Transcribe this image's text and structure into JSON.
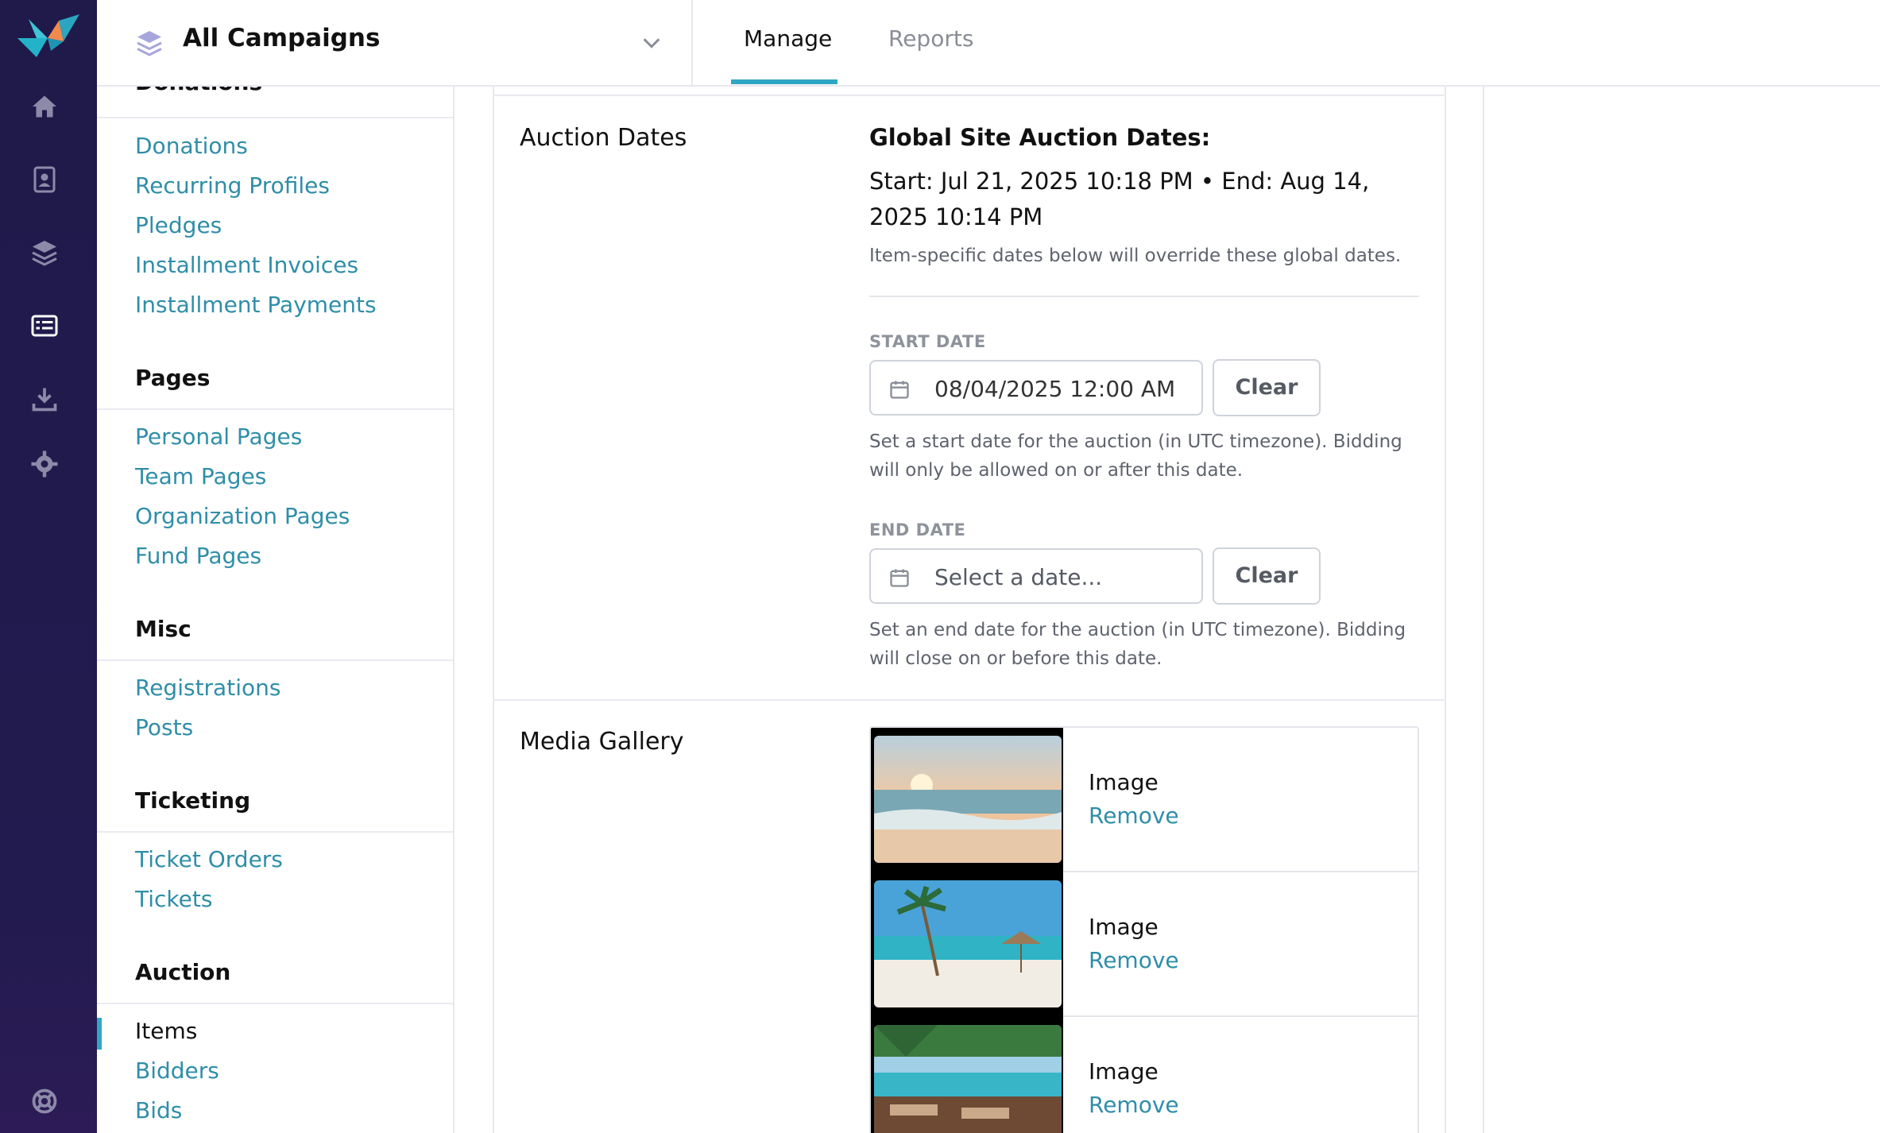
{
  "header": {
    "campaign_title": "All Campaigns",
    "tabs": [
      {
        "label": "Manage",
        "active": true
      },
      {
        "label": "Reports",
        "active": false
      }
    ]
  },
  "rail": {
    "icons": [
      "home-icon",
      "contacts-icon",
      "layers-icon",
      "list-card-icon",
      "download-icon",
      "gear-icon",
      "lifebuoy-icon"
    ]
  },
  "sidebar": {
    "cut_off_title": "Donations",
    "donations": [
      "Donations",
      "Recurring Profiles",
      "Pledges",
      "Installment Invoices",
      "Installment Payments"
    ],
    "pages_title": "Pages",
    "pages": [
      "Personal Pages",
      "Team Pages",
      "Organization Pages",
      "Fund Pages"
    ],
    "misc_title": "Misc",
    "misc": [
      "Registrations",
      "Posts"
    ],
    "ticketing_title": "Ticketing",
    "ticketing": [
      "Ticket Orders",
      "Tickets"
    ],
    "auction_title": "Auction",
    "auction": [
      "Items",
      "Bidders",
      "Bids"
    ],
    "active_item": "Items"
  },
  "auction_dates": {
    "label": "Auction Dates",
    "global_title": "Global Site Auction Dates:",
    "global_dates": "Start: Jul 21, 2025 10:18 PM  •  End: Aug 14, 2025 10:14 PM",
    "global_hint": "Item-specific dates below will override these global dates.",
    "start": {
      "label": "START DATE",
      "value": "08/04/2025 12:00 AM",
      "clear": "Clear",
      "hint": "Set a start date for the auction (in UTC timezone). Bidding will only be allowed on or after this date."
    },
    "end": {
      "label": "END DATE",
      "placeholder": "Select a date...",
      "clear": "Clear",
      "hint": "Set an end date for the auction (in UTC timezone). Bidding will close on or before this date."
    }
  },
  "media_gallery": {
    "label": "Media Gallery",
    "items": [
      {
        "kind": "Image",
        "action": "Remove"
      },
      {
        "kind": "Image",
        "action": "Remove"
      },
      {
        "kind": "Image",
        "action": "Remove"
      }
    ]
  },
  "colors": {
    "rail_bg": "#221b4f",
    "accent": "#2fa7c4",
    "link": "#2f8ea8"
  }
}
